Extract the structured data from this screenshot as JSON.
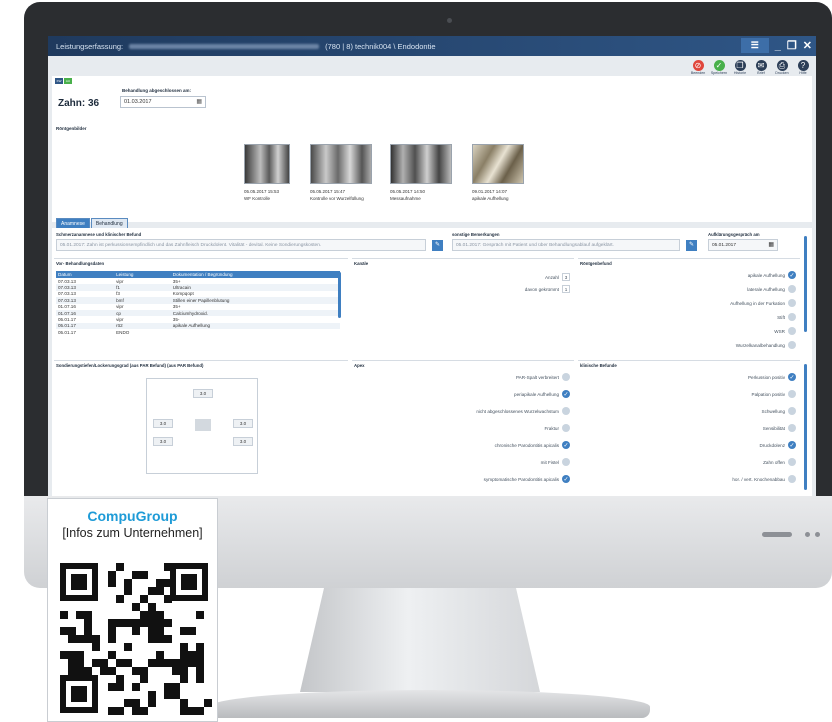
{
  "window": {
    "title_prefix": "Leistungserfassung:",
    "title_suffix": "(780 | 8) technik004 \\ Endodontie",
    "menu_button": "☰",
    "minimize": "_",
    "restore": "❐",
    "close": "✕"
  },
  "toolbar": [
    {
      "label": "Beenden",
      "icon": "cancel-icon",
      "color": "#e0463c",
      "glyph": "⊘"
    },
    {
      "label": "Speichern",
      "icon": "save-check-icon",
      "color": "#49b04b",
      "glyph": "✓"
    },
    {
      "label": "Historie",
      "icon": "history-icon",
      "color": "#2c3e57",
      "glyph": "❐"
    },
    {
      "label": "Brief",
      "icon": "letter-icon",
      "color": "#2c3e57",
      "glyph": "✉"
    },
    {
      "label": "Drucken",
      "icon": "print-icon",
      "color": "#2c3e57",
      "glyph": "⎙"
    },
    {
      "label": "Hilfe",
      "icon": "help-icon",
      "color": "#2c3e57",
      "glyph": "?"
    }
  ],
  "header": {
    "logo_left": "KW",
    "logo_right": "AU",
    "tooth_label": "Zahn:  36",
    "closed_label": "Behandlung abgeschlossen am:",
    "closed_date": "01.03.2017"
  },
  "xray": {
    "section_label": "Röntgenbilder",
    "images": [
      {
        "date": "05.05.2017 15:53",
        "caption": "WF Kontrolle"
      },
      {
        "date": "05.05.2017 15:47",
        "caption": "Kontrolle vor Wurzelfüllung"
      },
      {
        "date": "05.05.2017 14:50",
        "caption": "Messaufnahme"
      },
      {
        "date": "09.01.2017 14:07",
        "caption": "apikale Aufhellung"
      }
    ]
  },
  "tabs": [
    "Anamnese",
    "Behandlung"
  ],
  "anamnese": {
    "pain_label": "Schmerzanamnese und klinischer Befund",
    "pain_value": "05.01.2017: Zahn ist perkussionsempfindlich und das Zahnfleisch Druckdolent. Vitalität - devital. Keine Sondierungskosten.",
    "remarks_label": "sonstige Bemerkungen",
    "remarks_value": "05.01.2017: Gespräch mit Patient und über Behandlungsablauf aufgeklärt.",
    "consult_label": "Aufklärungsgespräch am",
    "consult_date": "05.01.2017"
  },
  "pretreat": {
    "label": "Vor- Behandlungsdaten",
    "columns": [
      "Datum",
      "Leistung",
      "Dokumentation / Begründung"
    ],
    "rows": [
      [
        "07.03.13",
        "vipr",
        "35+"
      ],
      [
        "07.03.13",
        "f1",
        "Ultracain"
      ],
      [
        "07.03.13",
        "f3",
        "Kompqopt"
      ],
      [
        "07.03.13",
        "bmf",
        "Stillen einer Papillenblutung"
      ],
      [
        "01.07.16",
        "vipr",
        "35+"
      ],
      [
        "01.07.16",
        "cp",
        "Calciumhydroxid."
      ],
      [
        "05.01.17",
        "vipr",
        "35-"
      ],
      [
        "05.01.17",
        "rö2",
        "apikale Aufhellung"
      ],
      [
        "05.01.17",
        "ENDO",
        ""
      ]
    ]
  },
  "canals": {
    "label": "Kanäle",
    "count_label": "Anzahl",
    "count_value": "3",
    "narrowed_label": "davon gekrümmt",
    "narrowed_value": "1"
  },
  "xray_findings": {
    "label": "Röntgenbefund",
    "items": [
      {
        "text": "apikale Aufhellung",
        "checked": true
      },
      {
        "text": "laterale Aufhellung",
        "checked": false
      },
      {
        "text": "Aufhellung in der Furkation",
        "checked": false
      },
      {
        "text": "Stift",
        "checked": false
      },
      {
        "text": "WSR",
        "checked": false
      },
      {
        "text": "Wurzelkanalbehandlung",
        "checked": false
      }
    ]
  },
  "probing": {
    "label": "Sondierungstiefen/Lockerungsgrad (aus PAR Befund) (aus PAR Befund)",
    "values": [
      "3.0",
      "3.0",
      "3.0",
      "3.0",
      "3.0"
    ]
  },
  "apex": {
    "label": "Apex",
    "items": [
      {
        "text": "PAR-Spalt verbreitert",
        "checked": false
      },
      {
        "text": "periapikale Aufhellung",
        "checked": true
      },
      {
        "text": "nicht abgeschlossenes Wurzelwachstum",
        "checked": false
      },
      {
        "text": "Fraktur",
        "checked": false
      },
      {
        "text": "chronische Parodontitis apicalis",
        "checked": true
      },
      {
        "text": "mit Fistel",
        "checked": false
      },
      {
        "text": "symptomatische Parodontitis apicalis",
        "checked": true
      }
    ]
  },
  "clinical": {
    "label": "klinische Befunde",
    "items": [
      {
        "text": "Perkussion positiv",
        "checked": true
      },
      {
        "text": "Palpation positiv",
        "checked": false
      },
      {
        "text": "Schwellung",
        "checked": false
      },
      {
        "text": "Sensibilität",
        "checked": false
      },
      {
        "text": "Druckdolenz",
        "checked": true
      },
      {
        "text": "Zahn offen",
        "checked": false
      },
      {
        "text": "hor. / vert. Knochenabbau",
        "checked": false
      }
    ]
  },
  "card": {
    "company": "CompuGroup",
    "info": "[Infos zum Unternehmen]"
  }
}
